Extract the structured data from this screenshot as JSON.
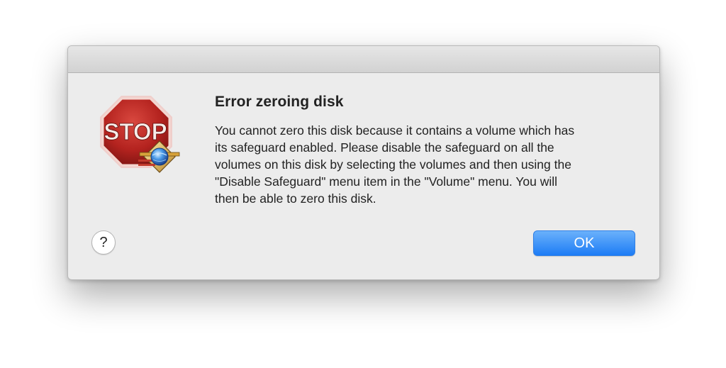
{
  "dialog": {
    "title": "Error zeroing disk",
    "message_lines": [
      "You cannot zero this disk because it contains a volume which has",
      "its safeguard enabled.  Please disable the safeguard on all the",
      "volumes on this disk by selecting the volumes and then using the",
      "\"Disable Safeguard\" menu item in the \"Volume\" menu.  You will",
      "then be able to zero this disk."
    ],
    "icon": {
      "name": "stop-sign-icon",
      "sign_text": "STOP",
      "badge": "globe-badge-icon"
    },
    "help_label": "?",
    "ok_label": "OK"
  },
  "colors": {
    "stop_red": "#b4231f",
    "accent_blue": "#1d7cf5",
    "dialog_bg": "#ececec"
  }
}
